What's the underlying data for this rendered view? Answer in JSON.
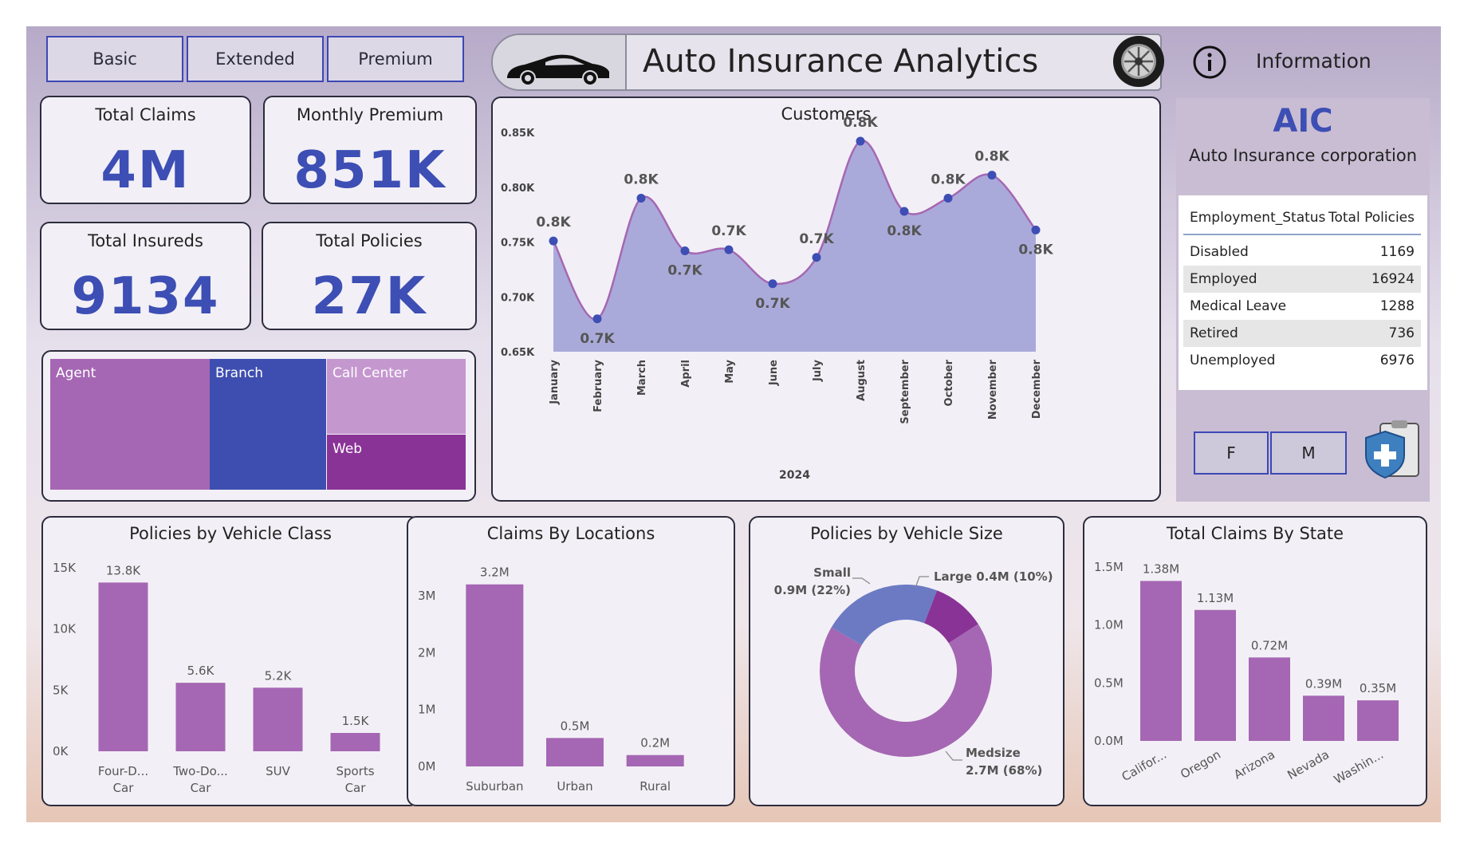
{
  "tiers": [
    "Basic",
    "Extended",
    "Premium"
  ],
  "header": {
    "title": "Auto Insurance Analytics",
    "info_label": "Information"
  },
  "kpis": [
    {
      "title": "Total Claims",
      "value": "4M"
    },
    {
      "title": "Monthly Premium",
      "value": "851K"
    },
    {
      "title": "Total Insureds",
      "value": "9134"
    },
    {
      "title": "Total Policies",
      "value": "27K"
    }
  ],
  "treemap": {
    "labels": [
      "Agent",
      "Branch",
      "Call Center",
      "Web"
    ]
  },
  "company": {
    "abbr": "AIC",
    "name": "Auto Insurance corporation"
  },
  "employment_table": {
    "headers": [
      "Employment_Status",
      "Total Policies"
    ],
    "rows": [
      [
        "Disabled",
        "1169"
      ],
      [
        "Employed",
        "16924"
      ],
      [
        "Medical Leave",
        "1288"
      ],
      [
        "Retired",
        "736"
      ],
      [
        "Unemployed",
        "6976"
      ]
    ]
  },
  "gender_buttons": [
    "F",
    "M"
  ],
  "colors": {
    "accent": "#3d4eb4",
    "purple": "#a567b3",
    "area": "#a5a5d8"
  },
  "chart_data": [
    {
      "type": "area",
      "title": "Customers",
      "xlabel": "2024",
      "ylabel": "",
      "categories": [
        "January",
        "February",
        "March",
        "April",
        "May",
        "June",
        "July",
        "August",
        "September",
        "October",
        "November",
        "December"
      ],
      "values": [
        751,
        680,
        790,
        742,
        743,
        712,
        736,
        842,
        778,
        790,
        811,
        761
      ],
      "data_labels": [
        "0.8K",
        "0.7K",
        "0.8K",
        "0.7K",
        "0.7K",
        "0.7K",
        "0.7K",
        "0.8K",
        "0.8K",
        "0.8K",
        "0.8K",
        "0.8K"
      ],
      "ylim": [
        650,
        850
      ],
      "yticks": [
        "0.85K",
        "0.80K",
        "0.75K",
        "0.70K",
        "0.65K"
      ]
    },
    {
      "type": "bar",
      "title": "Policies by Vehicle Class",
      "categories": [
        [
          "Four-D...",
          "Car"
        ],
        [
          "Two-Do...",
          "Car"
        ],
        [
          "SUV"
        ],
        [
          "Sports",
          "Car"
        ]
      ],
      "values": [
        13800,
        5600,
        5200,
        1500
      ],
      "data_labels": [
        "13.8K",
        "5.6K",
        "5.2K",
        "1.5K"
      ],
      "ylim": [
        0,
        15000
      ],
      "yticks": [
        "15K",
        "10K",
        "5K",
        "0K"
      ]
    },
    {
      "type": "bar",
      "title": "Claims By Locations",
      "categories": [
        "Suburban",
        "Urban",
        "Rural"
      ],
      "values": [
        3200000,
        500000,
        200000
      ],
      "data_labels": [
        "3.2M",
        "0.5M",
        "0.2M"
      ],
      "ylim": [
        0,
        3000000
      ],
      "yticks": [
        "3M",
        "2M",
        "1M",
        "0M"
      ]
    },
    {
      "type": "pie",
      "title": "Policies by Vehicle Size",
      "slices": [
        {
          "name": "Large",
          "value": 0.4,
          "pct": 10,
          "label": "Large 0.4M (10%)"
        },
        {
          "name": "Medsize",
          "value": 2.7,
          "pct": 68,
          "label": [
            "Medsize",
            "2.7M (68%)"
          ]
        },
        {
          "name": "Small",
          "value": 0.9,
          "pct": 22,
          "label": [
            "Small",
            "0.9M (22%)"
          ]
        }
      ]
    },
    {
      "type": "bar",
      "title": "Total Claims By State",
      "categories": [
        "Califor...",
        "Oregon",
        "Arizona",
        "Nevada",
        "Washin..."
      ],
      "values": [
        1.38,
        1.13,
        0.72,
        0.39,
        0.35
      ],
      "data_labels": [
        "1.38M",
        "1.13M",
        "0.72M",
        "0.39M",
        "0.35M"
      ],
      "ylim": [
        0,
        1.5
      ],
      "yticks": [
        "1.5M",
        "1.0M",
        "0.5M",
        "0.0M"
      ]
    }
  ]
}
